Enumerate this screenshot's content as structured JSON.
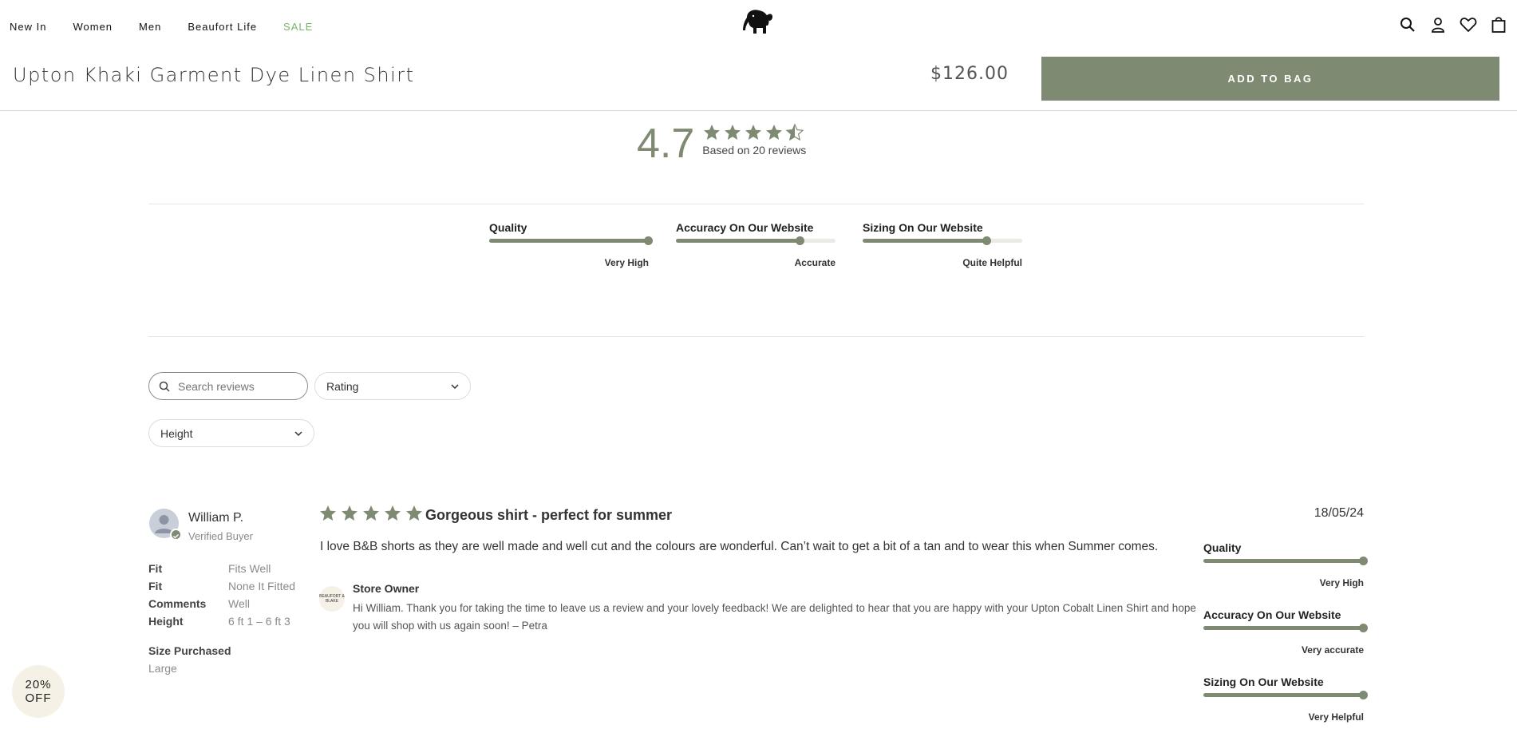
{
  "nav": {
    "links": [
      "New In",
      "Women",
      "Men",
      "Beaufort Life",
      "SALE"
    ],
    "sale_color": "#78b56a"
  },
  "icons": [
    "search-icon",
    "account-icon",
    "wishlist-heart-icon",
    "shopping-bag-icon"
  ],
  "product": {
    "title": "Upton Khaki Garment Dye Linen Shirt",
    "price": "$126.00",
    "add_to_bag": "ADD TO BAG"
  },
  "summary": {
    "average": "4.7",
    "rating_value": 4.7,
    "based_on": "Based on 20 reviews"
  },
  "attributes": [
    {
      "label": "Quality",
      "value": "Very High",
      "level": 1.0
    },
    {
      "label": "Accuracy On Our Website",
      "value": "Accurate",
      "level": 0.78
    },
    {
      "label": "Sizing On Our Website",
      "value": "Quite Helpful",
      "level": 0.78
    }
  ],
  "filters": {
    "search_placeholder": "Search reviews",
    "rating_label": "Rating",
    "height_label": "Height"
  },
  "review": {
    "name": "William P.",
    "verified": "Verified Buyer",
    "stars": 5,
    "title": "Gorgeous shirt - perfect for summer",
    "date": "18/05/24",
    "body": "I love B&B shorts as they are well made and well cut and the colours are wonderful. Can’t wait to get a bit of a tan and to wear this when Summer comes.",
    "meta": [
      {
        "key": "Fit",
        "value": "Fits Well"
      },
      {
        "key": "Fit",
        "value": "None It Fitted"
      },
      {
        "key": "Comments",
        "value": "Well"
      },
      {
        "key": "Height",
        "value": "6 ft 1 – 6 ft 3"
      }
    ],
    "size_purchased_label": "Size Purchased",
    "size_purchased": "Large",
    "owner_logo_text": "BEAUFORT & BLAKE",
    "owner_name": "Store Owner",
    "owner_reply": "Hi William. Thank you for taking the time to leave us a review and your lovely feedback! We are delighted to hear that you are happy with your Upton Cobalt Linen Shirt and hope you will shop with us again soon! – Petra",
    "attributes": [
      {
        "label": "Quality",
        "value": "Very High",
        "level": 1.0
      },
      {
        "label": "Accuracy On Our Website",
        "value": "Very accurate",
        "level": 1.0
      },
      {
        "label": "Sizing On Our Website",
        "value": "Very Helpful",
        "level": 1.0
      }
    ]
  },
  "promo_badge": {
    "line1": "20%",
    "line2": "OFF"
  },
  "colors": {
    "accent": "#7f8a72",
    "cream": "#f6f1e6"
  }
}
